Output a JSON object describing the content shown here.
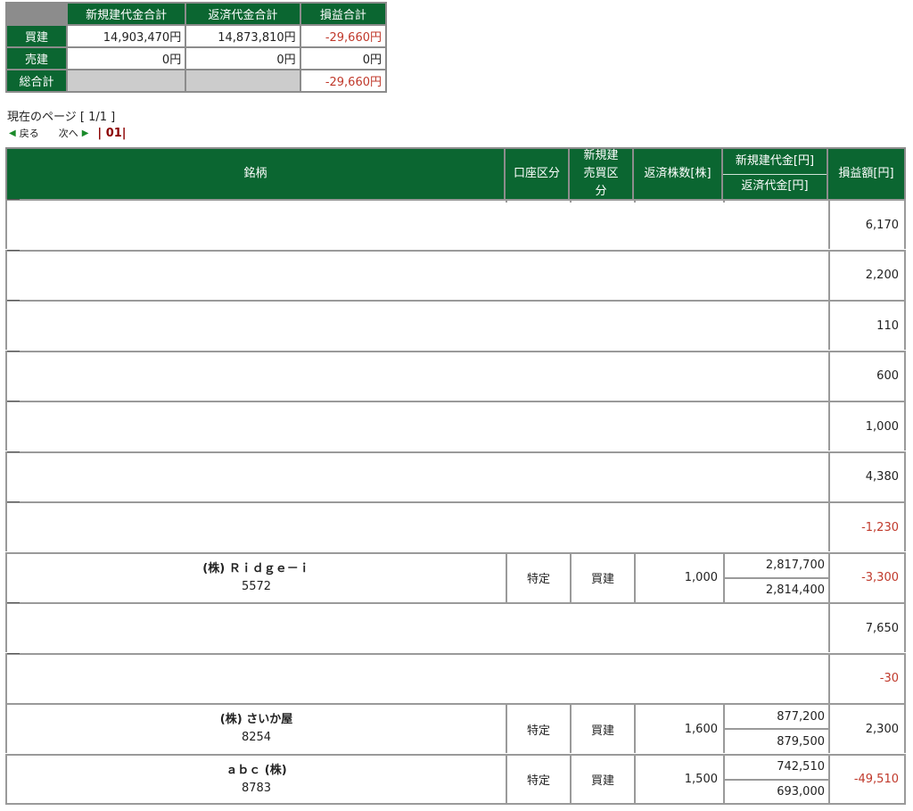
{
  "summary": {
    "headers": [
      "新規建代金合計",
      "返済代金合計",
      "損益合計"
    ],
    "rows": [
      {
        "label": "買建",
        "new": "14,903,470円",
        "repay": "14,873,810円",
        "pl": "-29,660円"
      },
      {
        "label": "売建",
        "new": "0円",
        "repay": "0円",
        "pl": "0円"
      },
      {
        "label": "総合計",
        "new": "",
        "repay": "",
        "pl": "-29,660円"
      }
    ]
  },
  "page_info": "現在のページ [ 1/1 ]",
  "pager": {
    "back": "戻る",
    "next": "次へ",
    "current": "01"
  },
  "table": {
    "headers": {
      "name": "銘柄",
      "account": "口座区分",
      "side": "新規建 売買区分",
      "qty": "返済株数[株]",
      "new_amount": "新規建代金[円]",
      "repay_amount": "返済代金[円]",
      "pl": "損益額[円]"
    },
    "rows": [
      {
        "pl": "6,170",
        "neg": false
      },
      {
        "pl": "2,200",
        "neg": false
      },
      {
        "pl": "110",
        "neg": false
      },
      {
        "pl": "600",
        "neg": false
      },
      {
        "pl": "1,000",
        "neg": false
      },
      {
        "pl": "4,380",
        "neg": false
      },
      {
        "pl": "-1,230",
        "neg": true
      },
      {
        "name": "(株) Ｒｉｄｇｅ－ｉ",
        "code": "5572",
        "account": "特定",
        "side": "買建",
        "qty": "1,000",
        "new_amount": "2,817,700",
        "repay_amount": "2,814,400",
        "pl": "-3,300",
        "neg": true
      },
      {
        "pl": "7,650",
        "neg": false
      },
      {
        "pl": "-30",
        "neg": true
      },
      {
        "name": "(株) さいか屋",
        "code": "8254",
        "account": "特定",
        "side": "買建",
        "qty": "1,600",
        "new_amount": "877,200",
        "repay_amount": "879,500",
        "pl": "2,300",
        "neg": false
      },
      {
        "name": "ａｂｃ (株)",
        "code": "8783",
        "account": "特定",
        "side": "買建",
        "qty": "1,500",
        "new_amount": "742,510",
        "repay_amount": "693,000",
        "pl": "-49,510",
        "neg": true
      }
    ]
  },
  "colors": {
    "header_green": "#0b6631",
    "negative": "#c0392b"
  }
}
